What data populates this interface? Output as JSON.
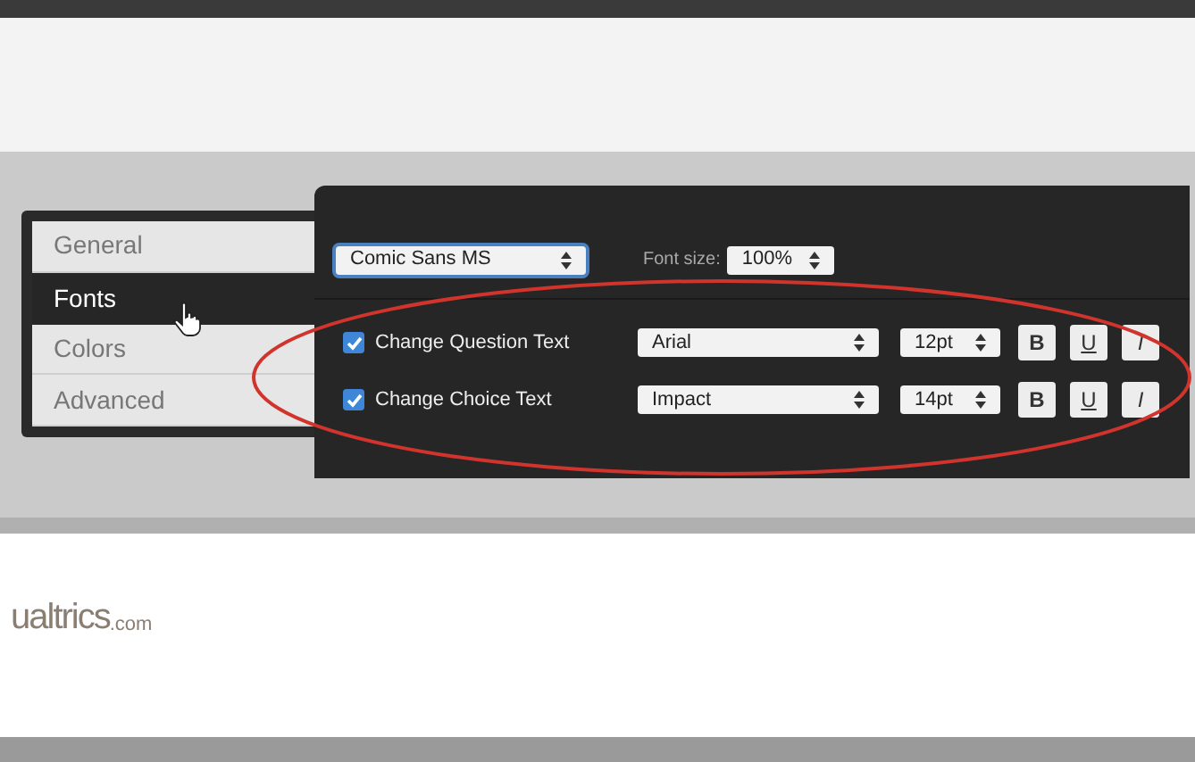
{
  "menu": [
    {
      "label": "General",
      "selected": false
    },
    {
      "label": "Fonts",
      "selected": true
    },
    {
      "label": "Colors",
      "selected": false
    },
    {
      "label": "Advanced",
      "selected": false
    }
  ],
  "font_family": {
    "value": "Comic Sans MS"
  },
  "font_size": {
    "label": "Font size:",
    "value": "100%"
  },
  "rows": [
    {
      "label": "Change Question Text",
      "checked": true,
      "font": "Arial",
      "size": "12pt",
      "styles": [
        "B",
        "U",
        "I"
      ]
    },
    {
      "label": "Change Choice Text",
      "checked": true,
      "font": "Impact",
      "size": "14pt",
      "styles": [
        "B",
        "U",
        "I"
      ]
    }
  ],
  "logo": {
    "name": "ualtrics",
    "suffix": ".com"
  }
}
